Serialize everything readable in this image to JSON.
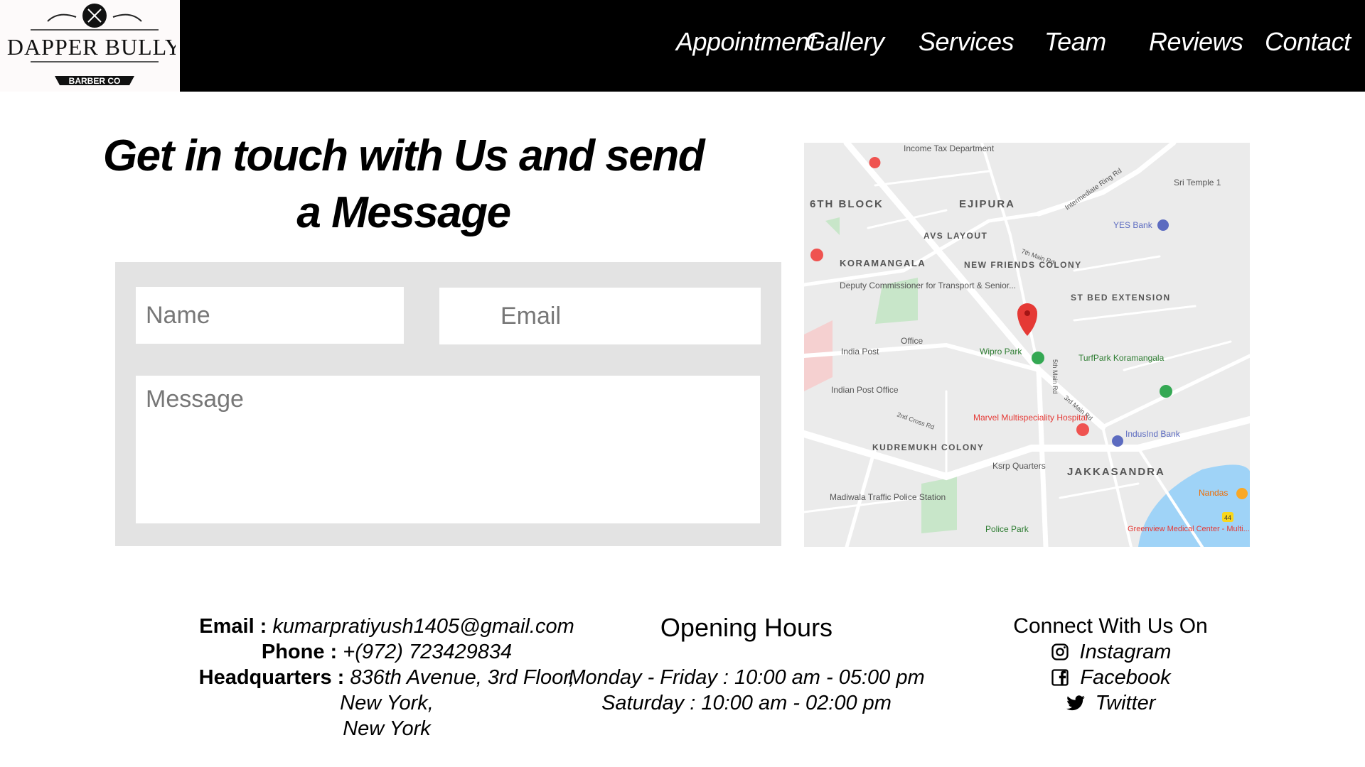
{
  "brand": {
    "logo_text": "DAPPER BULLY",
    "logo_sub": "BARBER CO"
  },
  "nav": {
    "items": [
      "Appointment",
      "Gallery",
      "Services",
      "Team",
      "Reviews",
      "Contact"
    ]
  },
  "contact": {
    "heading_line1": "Get in touch with Us and send",
    "heading_line2": "a Message",
    "name_placeholder": "Name",
    "email_placeholder": "Email",
    "message_placeholder": "Message"
  },
  "map": {
    "labels": [
      "Income Tax Department",
      "6TH BLOCK",
      "EJIPURA",
      "AVS LAYOUT",
      "KORAMANGALA",
      "NEW FRIENDS COLONY",
      "Deputy Commissioner for Transport & Senior...",
      "ST BED EXTENSION",
      "Sri Temple 1",
      "YES Bank",
      "Office",
      "India Post",
      "Wipro Park",
      "TurfPark Koramangala",
      "Indian Post Office",
      "Marvel Multispeciality Hospital",
      "IndusInd Bank",
      "KUDREMUKH COLONY",
      "Ksrp Quarters",
      "JAKKASANDRA",
      "Madiwala Traffic Police Station",
      "Nandas",
      "Police Park",
      "Greenview Medical Center - Multi...",
      "Intermediate Ring Rd",
      "7th Main Rd",
      "2nd Cross Rd",
      "5th Main Rd",
      "3rd Main Rd",
      "44"
    ],
    "colors": {
      "pin": "#e53935",
      "park": "#c8e6c9",
      "water": "#9fd3f7",
      "road": "#ffffff"
    }
  },
  "footer": {
    "email_label": "Email :",
    "email": "kumarpratiyush1405@gmail.com",
    "phone_label": "Phone :",
    "phone": "+(972) 723429834",
    "hq_label": "Headquarters :",
    "hq_line1": "836th Avenue, 3rd Floor,",
    "hq_line2": "New York,",
    "hq_line3": "New York",
    "hours_title": "Opening Hours",
    "hours_weekday": "Monday - Friday : 10:00 am - 05:00 pm",
    "hours_saturday": "Saturday : 10:00 am - 02:00 pm",
    "social_title": "Connect With Us On",
    "social": [
      {
        "label": "Instagram",
        "icon": "instagram-icon"
      },
      {
        "label": "Facebook",
        "icon": "facebook-icon"
      },
      {
        "label": "Twitter",
        "icon": "twitter-icon"
      }
    ]
  }
}
